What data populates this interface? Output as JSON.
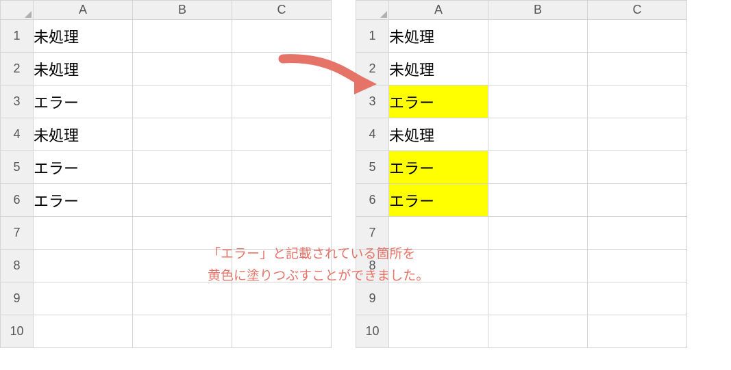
{
  "columns": [
    "A",
    "B",
    "C"
  ],
  "rowNumbers": [
    "1",
    "2",
    "3",
    "4",
    "5",
    "6",
    "7",
    "8",
    "9",
    "10"
  ],
  "leftSheet": {
    "cells": {
      "A1": "未処理",
      "A2": "未処理",
      "A3": "エラー",
      "A4": "未処理",
      "A5": "エラー",
      "A6": "エラー"
    }
  },
  "rightSheet": {
    "cells": {
      "A1": "未処理",
      "A2": "未処理",
      "A3": "エラー",
      "A4": "未処理",
      "A5": "エラー",
      "A6": "エラー"
    },
    "highlightedCells": [
      "A3",
      "A5",
      "A6"
    ]
  },
  "caption": {
    "line1": "「エラー」と記載されている箇所を",
    "line2": "黄色に塗りつぶすことができました。"
  },
  "arrowColor": "#e57368",
  "highlightColor": "#ffff00"
}
